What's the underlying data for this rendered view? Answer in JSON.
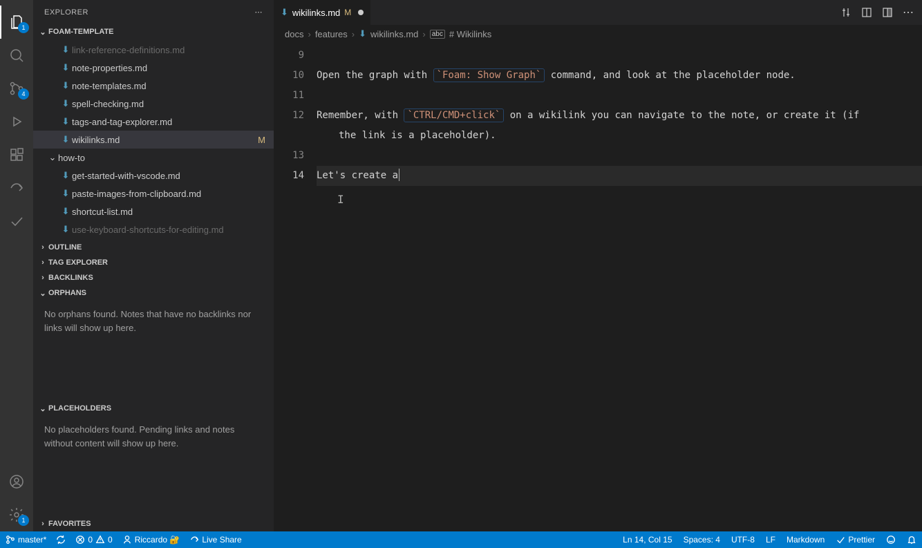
{
  "sidebar": {
    "title": "EXPLORER",
    "project": "FOAM-TEMPLATE",
    "files": [
      {
        "name": "link-reference-definitions.md",
        "faded": true
      },
      {
        "name": "note-properties.md"
      },
      {
        "name": "note-templates.md"
      },
      {
        "name": "spell-checking.md"
      },
      {
        "name": "tags-and-tag-explorer.md"
      },
      {
        "name": "wikilinks.md",
        "selected": true,
        "badge": "M"
      }
    ],
    "folder": "how-to",
    "subfiles": [
      {
        "name": "get-started-with-vscode.md"
      },
      {
        "name": "paste-images-from-clipboard.md"
      },
      {
        "name": "shortcut-list.md"
      },
      {
        "name": "use-keyboard-shortcuts-for-editing.md",
        "faded": true
      }
    ],
    "sections": {
      "outline": "OUTLINE",
      "tagExplorer": "TAG EXPLORER",
      "backlinks": "BACKLINKS",
      "orphans": "ORPHANS",
      "orphansBody": "No orphans found. Notes that have no backlinks nor links will show up here.",
      "placeholders": "PLACEHOLDERS",
      "placeholdersBody": "No placeholders found. Pending links and notes without content will show up here.",
      "favorites": "FAVORITES"
    }
  },
  "activity": {
    "explorerBadge": "1",
    "scmBadge": "4",
    "settingsBadge": "1"
  },
  "tab": {
    "filename": "wikilinks.md",
    "modBadge": "M"
  },
  "breadcrumbs": {
    "p1": "docs",
    "p2": "features",
    "p3": "wikilinks.md",
    "p4": "# Wikilinks"
  },
  "editor": {
    "lineNumbers": [
      "9",
      "10",
      "11",
      "12",
      "13",
      "14"
    ],
    "line10_a": "Open the graph with ",
    "line10_code": "`Foam: Show Graph`",
    "line10_b": " command, and look at the placeholder node.",
    "line12_a": "Remember, with ",
    "line12_code": "`CTRL/CMD+click`",
    "line12_b": " on a wikilink you can navigate to the note, or create it (if",
    "line12_wrap": "the link is a placeholder).",
    "line14": "Let's create a"
  },
  "status": {
    "branch": "master*",
    "sync": "",
    "errors": "0",
    "warnings": "0",
    "user": "Riccardo 🔐",
    "liveShare": "Live Share",
    "position": "Ln 14, Col 15",
    "spaces": "Spaces: 4",
    "encoding": "UTF-8",
    "eol": "LF",
    "lang": "Markdown",
    "prettier": "Prettier"
  }
}
